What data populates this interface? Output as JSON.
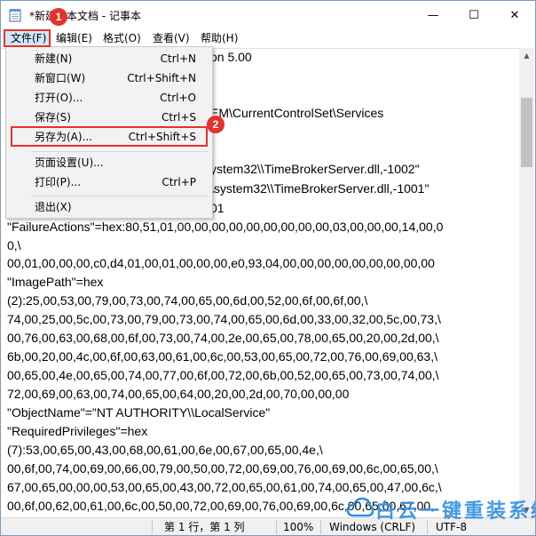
{
  "window": {
    "title": "*新建文本文档 - 记事本",
    "app_icon": "notepad-icon",
    "controls": {
      "minimize": "—",
      "maximize": "☐",
      "close": "✕"
    }
  },
  "menubar": {
    "items": [
      {
        "label": "文件(F)",
        "active": true
      },
      {
        "label": "编辑(E)"
      },
      {
        "label": "格式(O)"
      },
      {
        "label": "查看(V)"
      },
      {
        "label": "帮助(H)"
      }
    ]
  },
  "file_menu": {
    "items": [
      {
        "label": "新建(N)",
        "shortcut": "Ctrl+N"
      },
      {
        "label": "新窗口(W)",
        "shortcut": "Ctrl+Shift+N"
      },
      {
        "label": "打开(O)...",
        "shortcut": "Ctrl+O"
      },
      {
        "label": "保存(S)",
        "shortcut": "Ctrl+S"
      },
      {
        "label": "另存为(A)...",
        "shortcut": "Ctrl+Shift+S"
      },
      {
        "label": "页面设置(U)...",
        "shortcut": ""
      },
      {
        "label": "打印(P)...",
        "shortcut": "Ctrl+P"
      },
      {
        "label": "退出(X)",
        "shortcut": ""
      }
    ]
  },
  "annotations": {
    "badge1": "1",
    "badge2": "2",
    "color": "#e5322d"
  },
  "editor": {
    "visible_fragments": [
      "on 5.00",
      "EM\\CurrentControlSet\\Services",
      "ystem32\\\\TimeBrokerServer.dll,-1002\"",
      "\\system32\\\\TimeBrokerServer.dll,-1001\"",
      "01"
    ],
    "lines": [
      "\"FailureActions\"=hex:80,51,01,00,00,00,00,00,00,00,00,00,03,00,00,00,14,00,0",
      "0,\\",
      "00,01,00,00,00,c0,d4,01,00,01,00,00,00,e0,93,04,00,00,00,00,00,00,00,00,00",
      "\"ImagePath\"=hex",
      "(2):25,00,53,00,79,00,73,00,74,00,65,00,6d,00,52,00,6f,00,6f,00,\\",
      "74,00,25,00,5c,00,73,00,79,00,73,00,74,00,65,00,6d,00,33,00,32,00,5c,00,73,\\",
      "00,76,00,63,00,68,00,6f,00,73,00,74,00,2e,00,65,00,78,00,65,00,20,00,2d,00,\\",
      "6b,00,20,00,4c,00,6f,00,63,00,61,00,6c,00,53,00,65,00,72,00,76,00,69,00,63,\\",
      "00,65,00,4e,00,65,00,74,00,77,00,6f,00,72,00,6b,00,52,00,65,00,73,00,74,00,\\",
      "72,00,69,00,63,00,74,00,65,00,64,00,20,00,2d,00,70,00,00,00",
      "\"ObjectName\"=\"NT AUTHORITY\\\\LocalService\"",
      "\"RequiredPrivileges\"=hex",
      "(7):53,00,65,00,43,00,68,00,61,00,6e,00,67,00,65,00,4e,\\",
      "00,6f,00,74,00,69,00,66,00,79,00,50,00,72,00,69,00,76,00,69,00,6c,00,65,00,\\",
      "67,00,65,00,00,00,53,00,65,00,43,00,72,00,65,00,61,00,74,00,65,00,47,00,6c,\\",
      "00,6f,00,62,00,61,00,6c,00,50,00,72,00,69,00,76,00,69,00,6c,00,65,00,67,00,"
    ]
  },
  "statusbar": {
    "position": "第 1 行，第 1 列",
    "zoom": "100%",
    "line_ending": "Windows (CRLF)",
    "encoding": "UTF-8"
  },
  "watermark": {
    "text": "白云一键重装系统"
  },
  "colors": {
    "menu_highlight": "#cce8ff",
    "annotation_red": "#e5322d",
    "watermark_blue": "#2f8fe0"
  }
}
